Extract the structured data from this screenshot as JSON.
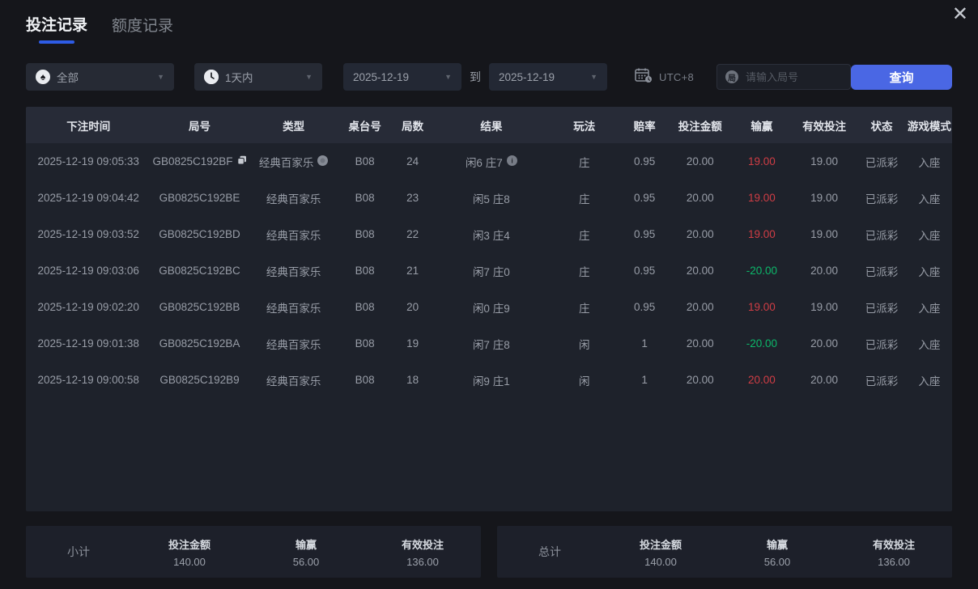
{
  "colors": {
    "page_bg": "#15161b",
    "panel_bg": "#1e222b",
    "header_bg": "#272b37",
    "accent": "#4a67e4",
    "underline": "#2e5ce6",
    "red": "#d03d45",
    "green": "#0cb86a"
  },
  "window": {
    "close_glyph": "✕"
  },
  "tabs": [
    {
      "label": "投注记录",
      "active": true
    },
    {
      "label": "额度记录",
      "active": false
    }
  ],
  "filters": {
    "game_select": "全部",
    "game_icon_glyph": "♠",
    "time_select": "1天内",
    "date_from": "2025-12-19",
    "to_label": "到",
    "date_to": "2025-12-19",
    "timezone": "UTC+8",
    "round_icon_char": "局",
    "round_placeholder": "请输入局号",
    "search_button": "查询",
    "chevron_glyph": "▼"
  },
  "table": {
    "headers": [
      "下注时间",
      "局号",
      "类型",
      "桌台号",
      "局数",
      "结果",
      "玩法",
      "赔率",
      "投注金额",
      "输赢",
      "有效投注",
      "状态",
      "游戏模式"
    ],
    "rows": [
      {
        "time": "2025-12-19 09:05:33",
        "round": "GB0825C192BF",
        "type": "经典百家乐",
        "tableNo": "B08",
        "shoe": "24",
        "result": "闲6 庄7",
        "bet": "庄",
        "odds": "0.95",
        "amount": "20.00",
        "winloss": "19.00",
        "winloss_color": "red",
        "valid": "19.00",
        "status": "已派彩",
        "mode": "入座",
        "icons": true
      },
      {
        "time": "2025-12-19 09:04:42",
        "round": "GB0825C192BE",
        "type": "经典百家乐",
        "tableNo": "B08",
        "shoe": "23",
        "result": "闲5 庄8",
        "bet": "庄",
        "odds": "0.95",
        "amount": "20.00",
        "winloss": "19.00",
        "winloss_color": "red",
        "valid": "19.00",
        "status": "已派彩",
        "mode": "入座",
        "icons": false
      },
      {
        "time": "2025-12-19 09:03:52",
        "round": "GB0825C192BD",
        "type": "经典百家乐",
        "tableNo": "B08",
        "shoe": "22",
        "result": "闲3 庄4",
        "bet": "庄",
        "odds": "0.95",
        "amount": "20.00",
        "winloss": "19.00",
        "winloss_color": "red",
        "valid": "19.00",
        "status": "已派彩",
        "mode": "入座",
        "icons": false
      },
      {
        "time": "2025-12-19 09:03:06",
        "round": "GB0825C192BC",
        "type": "经典百家乐",
        "tableNo": "B08",
        "shoe": "21",
        "result": "闲7 庄0",
        "bet": "庄",
        "odds": "0.95",
        "amount": "20.00",
        "winloss": "-20.00",
        "winloss_color": "green",
        "valid": "20.00",
        "status": "已派彩",
        "mode": "入座",
        "icons": false
      },
      {
        "time": "2025-12-19 09:02:20",
        "round": "GB0825C192BB",
        "type": "经典百家乐",
        "tableNo": "B08",
        "shoe": "20",
        "result": "闲0 庄9",
        "bet": "庄",
        "odds": "0.95",
        "amount": "20.00",
        "winloss": "19.00",
        "winloss_color": "red",
        "valid": "19.00",
        "status": "已派彩",
        "mode": "入座",
        "icons": false
      },
      {
        "time": "2025-12-19 09:01:38",
        "round": "GB0825C192BA",
        "type": "经典百家乐",
        "tableNo": "B08",
        "shoe": "19",
        "result": "闲7 庄8",
        "bet": "闲",
        "odds": "1",
        "amount": "20.00",
        "winloss": "-20.00",
        "winloss_color": "green",
        "valid": "20.00",
        "status": "已派彩",
        "mode": "入座",
        "icons": false
      },
      {
        "time": "2025-12-19 09:00:58",
        "round": "GB0825C192B9",
        "type": "经典百家乐",
        "tableNo": "B08",
        "shoe": "18",
        "result": "闲9 庄1",
        "bet": "闲",
        "odds": "1",
        "amount": "20.00",
        "winloss": "20.00",
        "winloss_color": "red",
        "valid": "20.00",
        "status": "已派彩",
        "mode": "入座",
        "icons": false
      }
    ]
  },
  "summary": [
    {
      "label": "小计",
      "amount_label": "投注金额",
      "amount": "140.00",
      "winloss_label": "输赢",
      "winloss": "56.00",
      "valid_label": "有效投注",
      "valid": "136.00"
    },
    {
      "label": "总计",
      "amount_label": "投注金额",
      "amount": "140.00",
      "winloss_label": "输赢",
      "winloss": "56.00",
      "valid_label": "有效投注",
      "valid": "136.00"
    }
  ]
}
